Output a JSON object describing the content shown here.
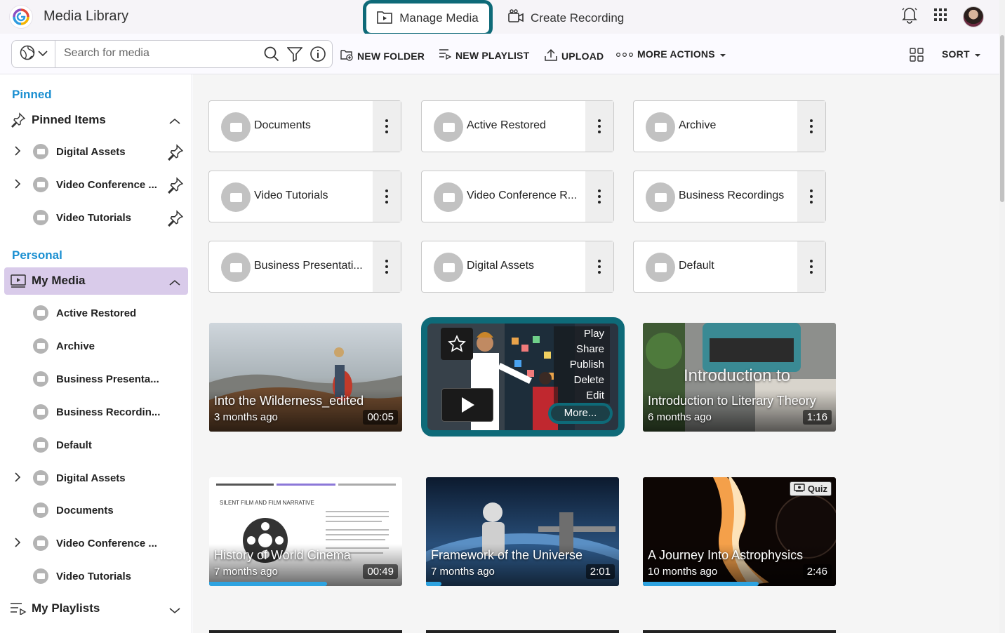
{
  "header": {
    "app_title": "Media Library",
    "nav_manage": "Manage Media",
    "nav_create": "Create Recording"
  },
  "toolbar": {
    "search_placeholder": "Search for media",
    "new_folder": "NEW FOLDER",
    "new_playlist": "NEW PLAYLIST",
    "upload": "UPLOAD",
    "more_actions": "MORE ACTIONS",
    "sort": "SORT"
  },
  "sidebar": {
    "pinned_label": "Pinned",
    "pinned_items_label": "Pinned Items",
    "pinned": [
      {
        "label": "Digital Assets",
        "expandable": true
      },
      {
        "label": "Video Conference ...",
        "expandable": true
      },
      {
        "label": "Video Tutorials",
        "expandable": false
      }
    ],
    "personal_label": "Personal",
    "my_media_label": "My Media",
    "my_media_items": [
      {
        "label": "Active Restored",
        "expandable": false
      },
      {
        "label": "Archive",
        "expandable": false
      },
      {
        "label": "Business Presenta...",
        "expandable": false
      },
      {
        "label": "Business Recordin...",
        "expandable": false
      },
      {
        "label": "Default",
        "expandable": false
      },
      {
        "label": "Digital Assets",
        "expandable": true
      },
      {
        "label": "Documents",
        "expandable": false
      },
      {
        "label": "Video Conference ...",
        "expandable": true
      },
      {
        "label": "Video Tutorials",
        "expandable": false
      }
    ],
    "my_playlists_label": "My Playlists"
  },
  "folders": [
    {
      "name": "Documents"
    },
    {
      "name": "Active Restored"
    },
    {
      "name": "Archive"
    },
    {
      "name": "Video Tutorials"
    },
    {
      "name": "Video Conference R..."
    },
    {
      "name": "Business Recordings"
    },
    {
      "name": "Business Presentati..."
    },
    {
      "name": "Digital Assets"
    },
    {
      "name": "Default"
    }
  ],
  "media": [
    {
      "title": "Into the Wilderness_edited",
      "age": "3 months ago",
      "duration": "00:05",
      "progress": 0
    },
    {
      "title": "",
      "age": "",
      "duration": "",
      "progress": 0
    },
    {
      "title": "Introduction to Literary Theory",
      "age": "6 months ago",
      "duration": "1:16",
      "progress": 0,
      "overlay_text": "Introduction to"
    },
    {
      "title": "History of World Cinema",
      "age": "7 months ago",
      "duration": "00:49",
      "progress": 0.61,
      "slide_heading": "SILENT FILM AND FILM NARRATIVE"
    },
    {
      "title": "Framework of the Universe",
      "age": "7 months ago",
      "duration": "2:01",
      "progress": 0.08
    },
    {
      "title": "A Journey Into Astrophysics",
      "age": "10 months ago",
      "duration": "2:46",
      "progress": 0.6,
      "badge": "Quiz"
    }
  ],
  "focus_menu": [
    "Play",
    "Share",
    "Publish",
    "Delete",
    "Edit"
  ],
  "focus_more": "More..."
}
